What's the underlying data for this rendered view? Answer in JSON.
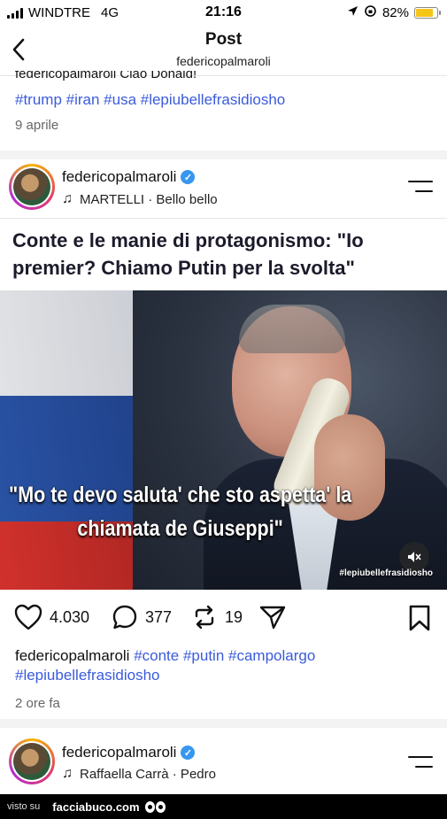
{
  "status_bar": {
    "carrier": "WINDTRE",
    "network": "4G",
    "time": "21:16",
    "battery": "82%",
    "battery_level": 0.82
  },
  "header": {
    "title": "Post",
    "subtitle": "federicopalmaroli"
  },
  "previous_post": {
    "caption_fragment": "federicopalmaroli Ciao Donald!",
    "hashtags": "#trump #iran #usa #lepiubellefrasidiosho",
    "date": "9 aprile"
  },
  "post": {
    "username": "federicopalmaroli",
    "music": "MARTELLI · Bello bello",
    "headline": "Conte e le manie di protagonismo: \"Io premier? Chiamo Putin per la svolta\"",
    "image_quote": "\"Mo te devo saluta' che sto aspetta' la chiamata de Giuseppi\"",
    "watermark": "#lepiubellefrasidiosho",
    "likes": "4.030",
    "comments": "377",
    "reposts": "19",
    "caption_user": "federicopalmaroli",
    "caption_hashtags": "#conte #putin #campolargo #lepiubellefrasidiosho",
    "time": "2 ore fa"
  },
  "next_post": {
    "username": "federicopalmaroli",
    "music": "Raffaella Carrà · Pedro"
  },
  "footer": {
    "visto_su": "visto su",
    "site": "facciabuco.com"
  },
  "colors": {
    "hashtag": "#3b5bdb",
    "verified": "#3797f0",
    "battery": "#f5c518"
  }
}
